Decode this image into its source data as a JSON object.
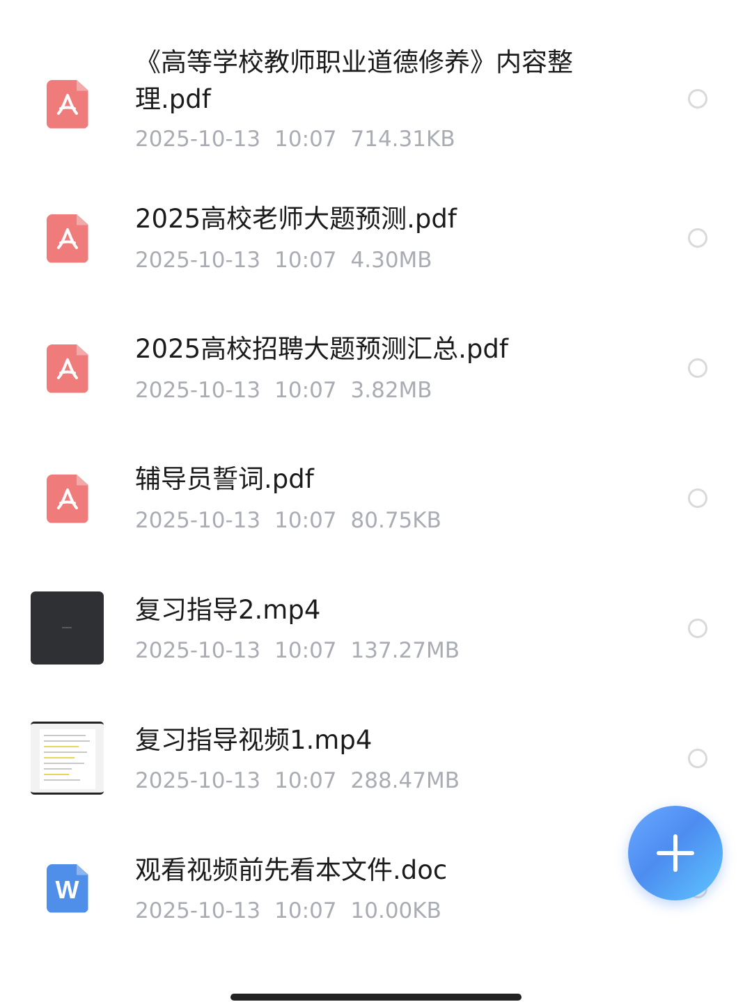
{
  "files": [
    {
      "name": "《高等学校教师职业道德修养》内容整理.pdf",
      "date": "2025-10-13",
      "time": "10:07",
      "size": "714.31KB",
      "type": "pdf",
      "icon": "pdf-icon"
    },
    {
      "name": "2025高校老师大题预测.pdf",
      "date": "2025-10-13",
      "time": "10:07",
      "size": "4.30MB",
      "type": "pdf",
      "icon": "pdf-icon"
    },
    {
      "name": "2025高校招聘大题预测汇总.pdf",
      "date": "2025-10-13",
      "time": "10:07",
      "size": "3.82MB",
      "type": "pdf",
      "icon": "pdf-icon"
    },
    {
      "name": "辅导员誓词.pdf",
      "date": "2025-10-13",
      "time": "10:07",
      "size": "80.75KB",
      "type": "pdf",
      "icon": "pdf-icon"
    },
    {
      "name": "复习指导2.mp4",
      "date": "2025-10-13",
      "time": "10:07",
      "size": "137.27MB",
      "type": "video",
      "icon": "video-thumbnail"
    },
    {
      "name": "复习指导视频1.mp4",
      "date": "2025-10-13",
      "time": "10:07",
      "size": "288.47MB",
      "type": "video",
      "icon": "video-thumbnail"
    },
    {
      "name": "观看视频前先看本文件.doc",
      "date": "2025-10-13",
      "time": "10:07",
      "size": "10.00KB",
      "type": "doc",
      "icon": "word-icon"
    }
  ],
  "fab": {
    "icon": "plus-icon"
  },
  "colors": {
    "pdf": "#ef7b7b",
    "word": "#4f8fea",
    "fab": "#4d8df0",
    "meta_text": "#a9adb3"
  }
}
